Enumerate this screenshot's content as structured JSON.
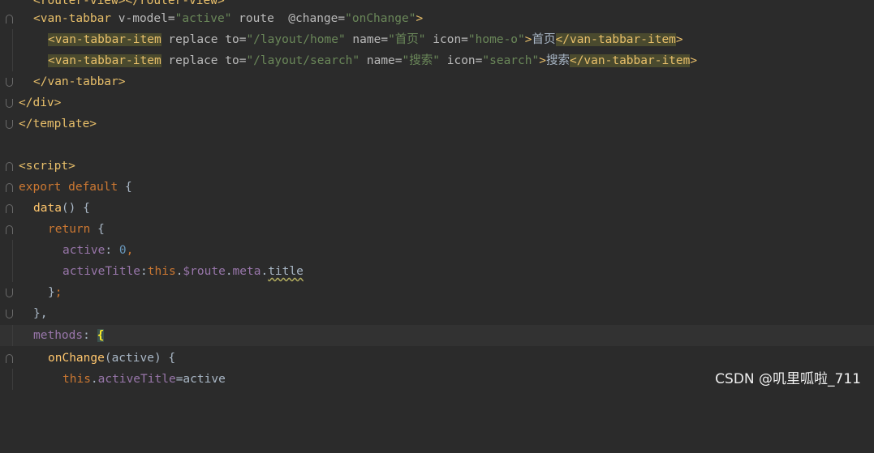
{
  "code": {
    "line0": "<router-view></router-view>",
    "l1": {
      "open": "<van-tabbar",
      "model_attr": " v-model=",
      "model_val": "\"active\"",
      "route": " route  @change=",
      "change_val": "\"onChange\"",
      "close": ">"
    },
    "l2": {
      "tag": "<van-tabbar-item",
      "a1": " replace to=",
      "v1": "\"/layout/home\"",
      "a2": " name=",
      "v2": "\"首页\"",
      "a3": " icon=",
      "v3": "\"home-o\"",
      "gt": ">",
      "text": "首页",
      "end": "</van-tabbar-item",
      "endgt": ">"
    },
    "l3": {
      "tag": "<van-tabbar-item",
      "a1": " replace to=",
      "v1": "\"/layout/search\"",
      "a2": " name=",
      "v2": "\"搜索\"",
      "a3": " icon=",
      "v3": "\"search\"",
      "gt": ">",
      "text": "搜索",
      "end": "</van-tabbar-item",
      "endgt": ">"
    },
    "l4": "</van-tabbar>",
    "l5": "</div>",
    "l6": "</template>",
    "l8": "<script>",
    "l9": {
      "kw1": "export",
      "kw2": " default",
      "rest": " {"
    },
    "l10": {
      "fn": "data",
      "rest": "() {"
    },
    "l11": {
      "kw": "return",
      "rest": " {"
    },
    "l12": {
      "prop": "active",
      "colon": ": ",
      "num": "0",
      "comma": ","
    },
    "l13": {
      "prop": "activeTitle",
      "colon": ":",
      "kw": "this",
      "dot1": ".",
      "p1": "$route",
      "dot2": ".",
      "p2": "meta",
      "dot3": ".",
      "p3": "title"
    },
    "l14": {
      "brace": "}",
      "semi": ";"
    },
    "l15": "},",
    "l16": {
      "prop": "methods",
      "colon": ": ",
      "brace": "{"
    },
    "l17": {
      "fn": "onChange",
      "rest": "(active) {"
    },
    "l18": {
      "kw": "this",
      "dot": ".",
      "prop": "activeTitle",
      "rest": "=active"
    }
  },
  "watermark": "CSDN @叽里呱啦_711"
}
